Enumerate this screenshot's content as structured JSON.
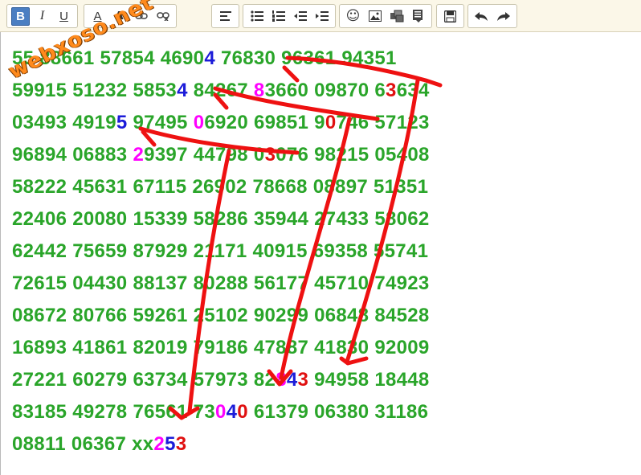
{
  "toolbar": {
    "groups": [
      [
        "bold-button",
        "italic-button",
        "underline-button"
      ],
      [
        "text-color-button",
        "font-size-button",
        "link-button",
        "unlink-button"
      ],
      [
        "align-left-button"
      ],
      [
        "bulleted-list-button",
        "numbered-list-button",
        "outdent-button",
        "indent-button"
      ],
      [
        "emoji-button",
        "image-button",
        "gallery-button",
        "document-button"
      ],
      [
        "save-button"
      ],
      [
        "undo-button",
        "redo-button"
      ]
    ],
    "bold_label": "B",
    "italic_label": "I",
    "underline_label": "U",
    "text_color_label": "A",
    "font_size_label": "A",
    "emoji_glyph": "☺"
  },
  "watermark": "webxoso.net",
  "rows": [
    [
      "55",
      "88661",
      "57854",
      "46904",
      "76830",
      "96361",
      "94351"
    ],
    [
      "59915",
      "51232",
      "58534",
      "84267",
      "83660",
      "09870",
      "63634"
    ],
    [
      "03493",
      "49195",
      "97495",
      "06920",
      "69851",
      "90746",
      "57123"
    ],
    [
      "96894",
      "06883",
      "29397",
      "44798",
      "03076",
      "98215",
      "05408"
    ],
    [
      "58222",
      "45631",
      "67115",
      "26902",
      "78668",
      "08897",
      "51351"
    ],
    [
      "22406",
      "20080",
      "15339",
      "58286",
      "35944",
      "27433",
      "58062"
    ],
    [
      "62442",
      "75659",
      "87929",
      "21171",
      "40915",
      "69358",
      "55741"
    ],
    [
      "72615",
      "04430",
      "88137",
      "80288",
      "56177",
      "45710",
      "74923"
    ],
    [
      "08672",
      "80766",
      "59261",
      "25102",
      "90299",
      "06848",
      "84528"
    ],
    [
      "16893",
      "41861",
      "82019",
      "79186",
      "47887",
      "41830",
      "92009"
    ],
    [
      "27221",
      "60279",
      "63734",
      "57973",
      "82843",
      "94958",
      "18448"
    ],
    [
      "83185",
      "49278",
      "76561",
      "73040",
      "61379",
      "06380",
      "31186"
    ],
    [
      "08811",
      "06367",
      "xx253"
    ]
  ],
  "highlights": [
    {
      "row": 0,
      "col": 3,
      "pos": 4,
      "color": "blue"
    },
    {
      "row": 1,
      "col": 2,
      "pos": 4,
      "color": "blue"
    },
    {
      "row": 1,
      "col": 4,
      "pos": 0,
      "color": "magenta"
    },
    {
      "row": 1,
      "col": 6,
      "pos": 1,
      "color": "red"
    },
    {
      "row": 2,
      "col": 1,
      "pos": 4,
      "color": "blue"
    },
    {
      "row": 2,
      "col": 3,
      "pos": 0,
      "color": "magenta"
    },
    {
      "row": 2,
      "col": 5,
      "pos": 1,
      "color": "red"
    },
    {
      "row": 3,
      "col": 2,
      "pos": 0,
      "color": "magenta"
    },
    {
      "row": 3,
      "col": 4,
      "pos": 1,
      "color": "red"
    },
    {
      "row": 10,
      "col": 4,
      "pos": 2,
      "color": "magenta"
    },
    {
      "row": 10,
      "col": 4,
      "pos": 3,
      "color": "blue"
    },
    {
      "row": 10,
      "col": 4,
      "pos": 4,
      "color": "red"
    },
    {
      "row": 11,
      "col": 3,
      "pos": 2,
      "color": "magenta"
    },
    {
      "row": 11,
      "col": 3,
      "pos": 3,
      "color": "blue"
    },
    {
      "row": 11,
      "col": 3,
      "pos": 4,
      "color": "red"
    },
    {
      "row": 12,
      "col": 2,
      "pos": 2,
      "color": "magenta"
    },
    {
      "row": 12,
      "col": 2,
      "pos": 3,
      "color": "blue"
    },
    {
      "row": 12,
      "col": 2,
      "pos": 4,
      "color": "red"
    }
  ],
  "colors": {
    "default_text": "#2aa52a",
    "blue": "#1c1cd9",
    "magenta": "#ff00ff",
    "red": "#e01010",
    "annotation_stroke": "#ee1111",
    "watermark": "#ff8a1c"
  }
}
